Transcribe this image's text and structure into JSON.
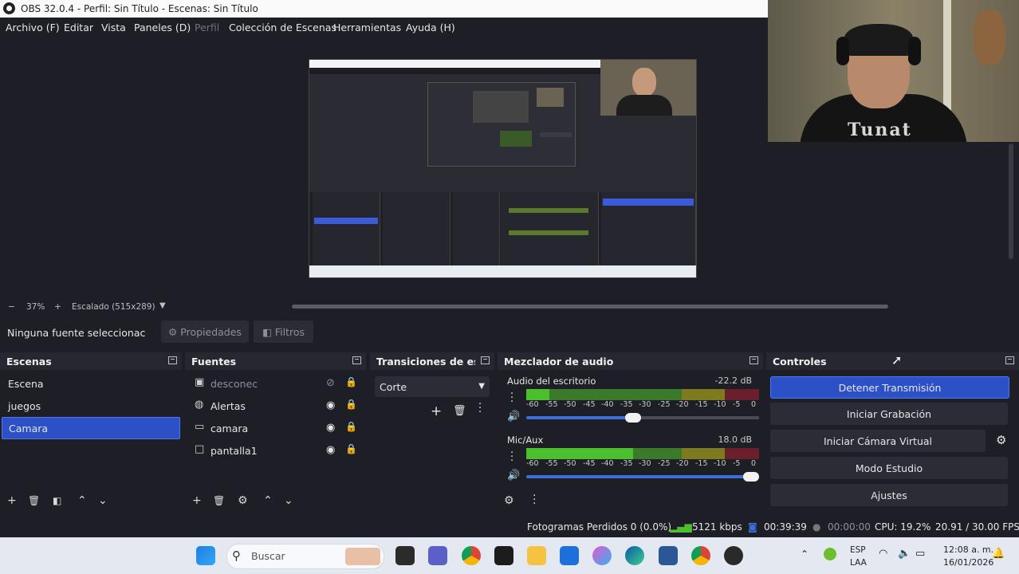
{
  "window": {
    "title": "OBS 32.0.4 - Perfil: Sin Título - Escenas: Sin Título"
  },
  "menu": [
    "Archivo (F)",
    "Editar",
    "Vista",
    "Paneles (D)",
    "Perfil",
    "Colección de Escenas",
    "Herramientas",
    "Ayuda (H)"
  ],
  "zoom": {
    "minus": "−",
    "percent": "37%",
    "plus": "+",
    "scale_label": "Escalado (515x289)"
  },
  "source_toolbar": {
    "no_source": "Ninguna fuente seleccionac",
    "properties": "Propiedades",
    "filters": "Filtros"
  },
  "scenes": {
    "title": "Escenas",
    "items": [
      "Escena",
      "juegos",
      "Camara"
    ],
    "selected": "Camara"
  },
  "sources": {
    "title": "Fuentes",
    "items": [
      {
        "name": "desconec",
        "icon": "image-icon",
        "visible": false
      },
      {
        "name": "Alertas",
        "icon": "browser-icon",
        "visible": true
      },
      {
        "name": "camara",
        "icon": "camera-icon",
        "visible": true
      },
      {
        "name": "pantalla1",
        "icon": "display-icon",
        "visible": true
      }
    ]
  },
  "transitions": {
    "title": "Transiciones de es...",
    "selected": "Corte"
  },
  "mixer": {
    "title": "Mezclador de audio",
    "channels": [
      {
        "name": "Audio del escritorio",
        "db": "-22.2 dB",
        "level": 0.1,
        "volume": 0.46
      },
      {
        "name": "Mic/Aux",
        "db": "18.0 dB",
        "level": 0.46,
        "volume": 1.0
      }
    ],
    "scale": [
      "-60",
      "-55",
      "-50",
      "-45",
      "-40",
      "-35",
      "-30",
      "-25",
      "-20",
      "-15",
      "-10",
      "-5",
      "0"
    ]
  },
  "controls": {
    "title": "Controles",
    "buttons": [
      "Detener Transmisión",
      "Iniciar Grabación",
      "Iniciar Cámara Virtual",
      "Modo Estudio",
      "Ajustes"
    ]
  },
  "status": {
    "dropped": "Fotogramas Perdidos 0 (0.0%)",
    "bitrate": "5121 kbps",
    "stream_time": "00:39:39",
    "rec_time": "00:00:00",
    "cpu": "CPU: 19.2%",
    "fps": "20.91 / 30.00 FPS"
  },
  "taskbar": {
    "search": "Buscar",
    "lang_top": "ESP",
    "lang_bottom": "LAA",
    "time": "12:08 a. m.",
    "date": "16/01/2026"
  },
  "webcam": {
    "shirt_text": "Tunat"
  },
  "colors": {
    "accent": "#2c50c6",
    "background": "#1e1f26",
    "panel": "#262730",
    "meter_green": "#4cbf2f"
  }
}
